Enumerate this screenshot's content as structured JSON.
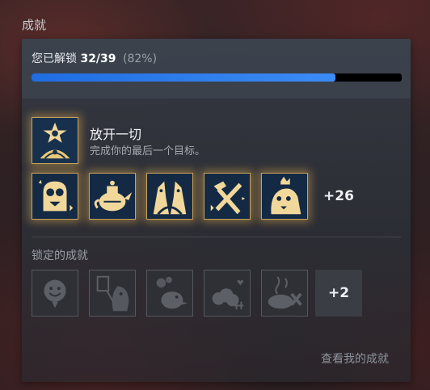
{
  "section_title": "成就",
  "progress": {
    "label": "您已解锁",
    "count": "32/39",
    "percent_text": "(82%)",
    "fraction": 0.82
  },
  "featured": {
    "name": "放开一切",
    "description": "完成你的最后一个目标。",
    "icon": "star-character-icon"
  },
  "unlocked": {
    "icons": [
      "owl-knight-icon",
      "teapot-icon",
      "twin-figures-icon",
      "hammer-cross-icon",
      "bird-crown-icon"
    ],
    "more_label": "+26"
  },
  "locked": {
    "title": "锁定的成就",
    "icons": [
      "smiley-sign-icon",
      "lantern-character-icon",
      "crow-balloon-icon",
      "sheep-hearts-icon",
      "soup-bowl-icon"
    ],
    "more_label": "+2"
  },
  "view_link": "查看我的成就",
  "colors": {
    "progress_fill": "#2f7ef0",
    "badge_gold": "#f1d89a",
    "badge_bg": "#142a44"
  }
}
